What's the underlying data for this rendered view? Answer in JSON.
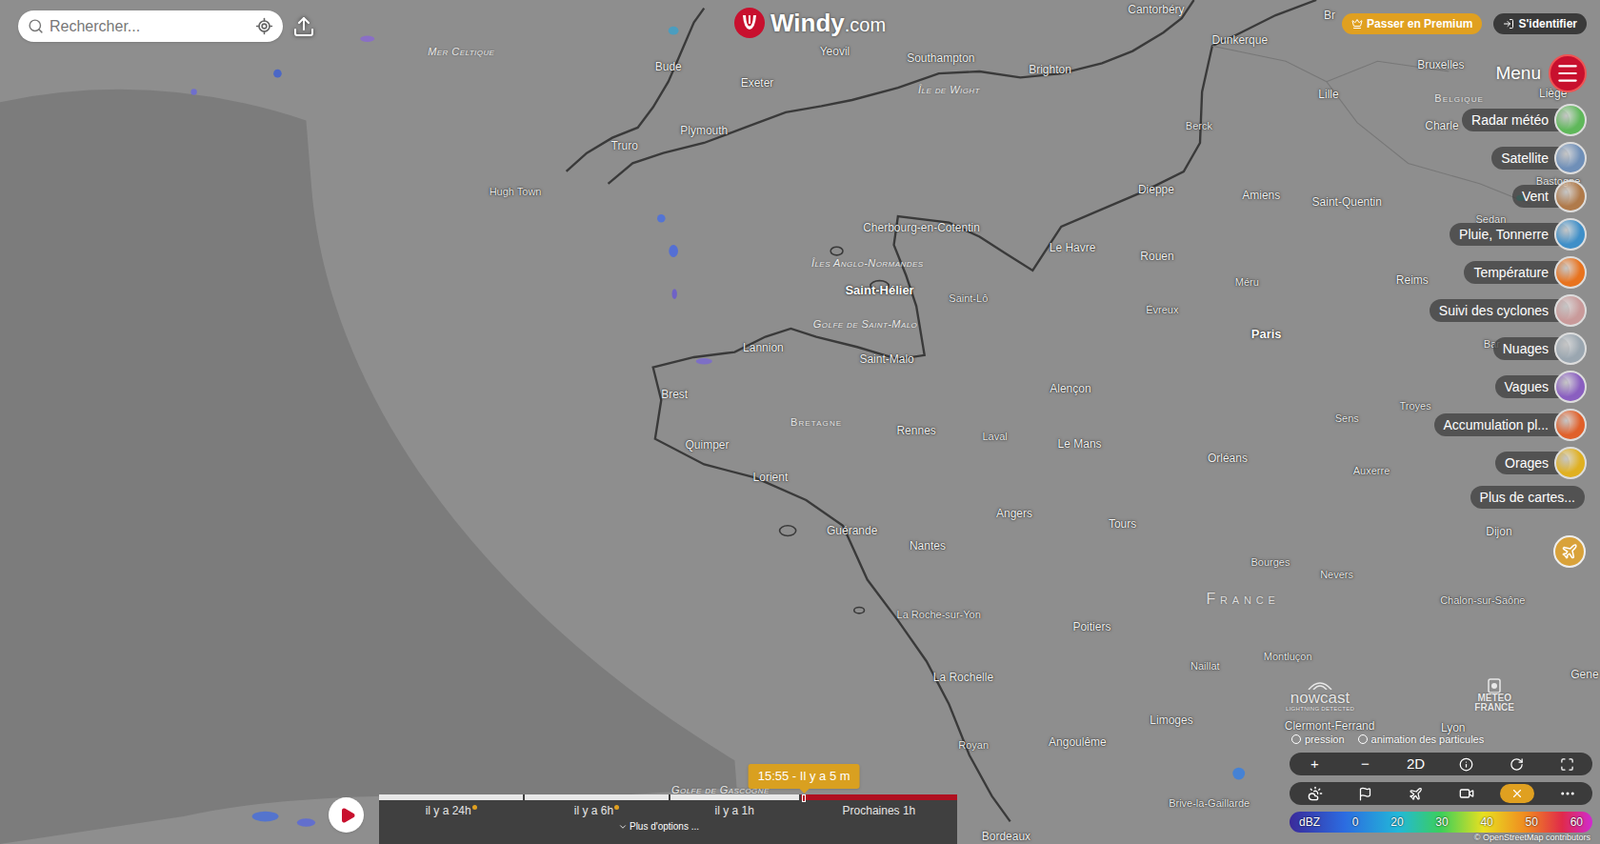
{
  "search": {
    "placeholder": "Rechercher..."
  },
  "logo": {
    "text": "Windy",
    "suffix": ".com"
  },
  "header_buttons": [
    {
      "label": "Passer en Premium",
      "kind": "premium"
    },
    {
      "label": "S'identifier",
      "kind": "login"
    }
  ],
  "menu": {
    "label": "Menu"
  },
  "layers": [
    {
      "label": "Radar météo",
      "color": "#5fb85a"
    },
    {
      "label": "Satellite",
      "color": "#6f8fb8"
    },
    {
      "label": "Vent",
      "color": "#b07a4a"
    },
    {
      "label": "Pluie, Tonnerre",
      "color": "#3f8fc8"
    },
    {
      "label": "Température",
      "color": "#e8731e"
    },
    {
      "label": "Suivi des cyclones",
      "color": "#c99a9a"
    },
    {
      "label": "Nuages",
      "color": "#9aa6b0"
    },
    {
      "label": "Vagues",
      "color": "#8a5fc0"
    },
    {
      "label": "Accumulation pl...",
      "color": "#e0602a"
    },
    {
      "label": "Orages",
      "color": "#e0b020"
    }
  ],
  "more_maps": "Plus de cartes...",
  "map": {
    "labels": [
      {
        "text": "Mer Celtique",
        "kind": "sea"
      },
      {
        "text": "Cantorbéry",
        "kind": "city"
      },
      {
        "text": "Br",
        "kind": "city"
      },
      {
        "text": "Bude",
        "kind": "city"
      },
      {
        "text": "Exeter",
        "kind": "city"
      },
      {
        "text": "Yeovil",
        "kind": "city"
      },
      {
        "text": "Southampton",
        "kind": "city"
      },
      {
        "text": "Brighton",
        "kind": "city"
      },
      {
        "text": "Dunkerque",
        "kind": "city"
      },
      {
        "text": "Bruxelles",
        "kind": "city"
      },
      {
        "text": "Liège",
        "kind": "city"
      },
      {
        "text": "Île de Wight",
        "kind": "sea"
      },
      {
        "text": "Truro",
        "kind": "city"
      },
      {
        "text": "Plymouth",
        "kind": "city"
      },
      {
        "text": "Lille",
        "kind": "city"
      },
      {
        "text": "Belgique",
        "kind": "region"
      },
      {
        "text": "Charle",
        "kind": "city"
      },
      {
        "text": "Berck",
        "kind": "small"
      },
      {
        "text": "Hugh Town",
        "kind": "small"
      },
      {
        "text": "Dieppe",
        "kind": "city"
      },
      {
        "text": "Amiens",
        "kind": "city"
      },
      {
        "text": "Saint-Quentin",
        "kind": "city"
      },
      {
        "text": "Bastogne",
        "kind": "small"
      },
      {
        "text": "Sedan",
        "kind": "small"
      },
      {
        "text": "Cherbourg-en-Cotentin",
        "kind": "city"
      },
      {
        "text": "Le Havre",
        "kind": "city"
      },
      {
        "text": "Rouen",
        "kind": "city"
      },
      {
        "text": "Îles Anglo-Normandes",
        "kind": "sea"
      },
      {
        "text": "Saint-Hélier",
        "kind": "capital"
      },
      {
        "text": "Saint-Lô",
        "kind": "small"
      },
      {
        "text": "Évreux",
        "kind": "small"
      },
      {
        "text": "Méru",
        "kind": "small"
      },
      {
        "text": "Reims",
        "kind": "city"
      },
      {
        "text": "Golfe de Saint-Malo",
        "kind": "sea"
      },
      {
        "text": "Paris",
        "kind": "capital"
      },
      {
        "text": "Lannion",
        "kind": "city"
      },
      {
        "text": "Saint-Malo",
        "kind": "city"
      },
      {
        "text": "Bar",
        "kind": "small"
      },
      {
        "text": "Troyes",
        "kind": "small"
      },
      {
        "text": "Sens",
        "kind": "small"
      },
      {
        "text": "Alençon",
        "kind": "city"
      },
      {
        "text": "Brest",
        "kind": "city"
      },
      {
        "text": "Bretagne",
        "kind": "region"
      },
      {
        "text": "Rennes",
        "kind": "city"
      },
      {
        "text": "Laval",
        "kind": "small"
      },
      {
        "text": "Le Mans",
        "kind": "city"
      },
      {
        "text": "Quimper",
        "kind": "city"
      },
      {
        "text": "Orléans",
        "kind": "city"
      },
      {
        "text": "Auxerre",
        "kind": "small"
      },
      {
        "text": "Lorient",
        "kind": "city"
      },
      {
        "text": "Angers",
        "kind": "city"
      },
      {
        "text": "Tours",
        "kind": "city"
      },
      {
        "text": "Dijon",
        "kind": "city"
      },
      {
        "text": "Guérande",
        "kind": "city"
      },
      {
        "text": "Nantes",
        "kind": "city"
      },
      {
        "text": "Bourges",
        "kind": "small"
      },
      {
        "text": "Nevers",
        "kind": "small"
      },
      {
        "text": "France",
        "kind": "country"
      },
      {
        "text": "Chalon-sur-Saône",
        "kind": "small"
      },
      {
        "text": "La Roche-sur-Yon",
        "kind": "small"
      },
      {
        "text": "Poitiers",
        "kind": "city"
      },
      {
        "text": "Naillat",
        "kind": "small"
      },
      {
        "text": "Montluçon",
        "kind": "small"
      },
      {
        "text": "Gene",
        "kind": "city"
      },
      {
        "text": "La Rochelle",
        "kind": "city"
      },
      {
        "text": "Limoges",
        "kind": "city"
      },
      {
        "text": "Clermont-Ferrand",
        "kind": "city"
      },
      {
        "text": "Lyon",
        "kind": "city"
      },
      {
        "text": "Angoulême",
        "kind": "city"
      },
      {
        "text": "Royan",
        "kind": "small"
      },
      {
        "text": "Golfe de Gascogne",
        "kind": "sea"
      },
      {
        "text": "Brive-la-Gaillarde",
        "kind": "small"
      },
      {
        "text": "Bordeaux",
        "kind": "city"
      }
    ]
  },
  "providers": {
    "nowcast": "nowcast",
    "nowcast_sub": "LIGHTNING DETECTED",
    "meteo": "METEO",
    "france": "FRANCE"
  },
  "toggles": [
    {
      "label": "pression",
      "on": false
    },
    {
      "label": "animation des particules",
      "on": false
    }
  ],
  "controls": {
    "zoom_in": "+",
    "zoom_out": "−",
    "view": "2D"
  },
  "legend": {
    "unit": "dBZ",
    "ticks": [
      "0",
      "20",
      "30",
      "40",
      "50",
      "60"
    ]
  },
  "attribution": "© OpenStreetMap contributors",
  "timeline": {
    "segments": [
      {
        "label": "il y a 24h",
        "kind": "past"
      },
      {
        "label": "il y a 6h",
        "kind": "past"
      },
      {
        "label": "il y a 1h",
        "kind": "past"
      },
      {
        "label": "Prochaines 1h",
        "kind": "future"
      }
    ],
    "more": "Plus d'options ...",
    "current": "15:55 - Il y a 5 m",
    "level": 0.735
  }
}
